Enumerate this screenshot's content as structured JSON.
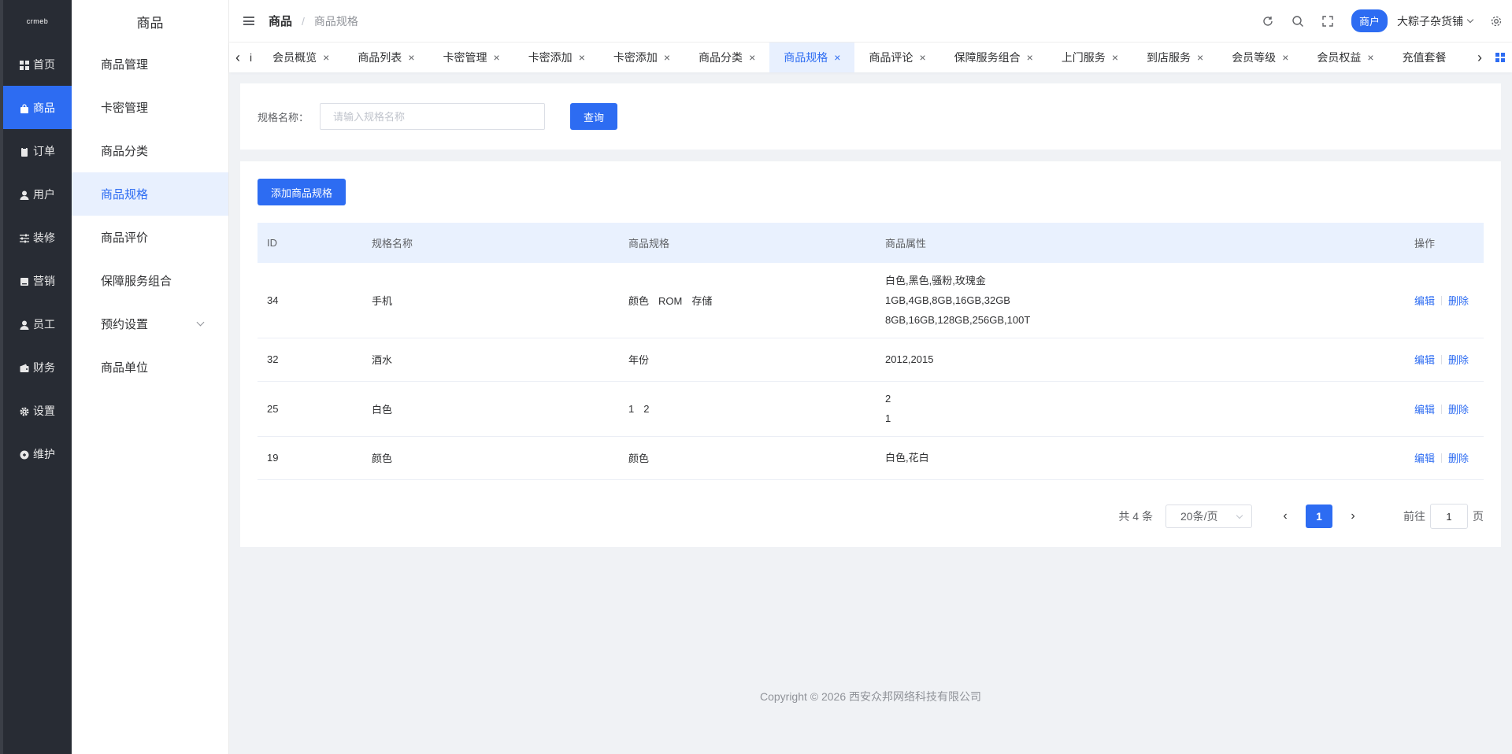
{
  "rail": {
    "logo": "crmeb",
    "items": [
      {
        "label": "首页",
        "icon": "grid-icon"
      },
      {
        "label": "商品",
        "icon": "bag-icon",
        "active": true
      },
      {
        "label": "订单",
        "icon": "clipboard-icon"
      },
      {
        "label": "用户",
        "icon": "user-icon"
      },
      {
        "label": "装修",
        "icon": "sliders-icon"
      },
      {
        "label": "营销",
        "icon": "book-icon"
      },
      {
        "label": "员工",
        "icon": "staff-icon"
      },
      {
        "label": "财务",
        "icon": "wallet-icon"
      },
      {
        "label": "设置",
        "icon": "gear-icon"
      },
      {
        "label": "维护",
        "icon": "wrench-icon"
      }
    ]
  },
  "sidebar": {
    "title": "商品",
    "items": [
      {
        "label": "商品管理"
      },
      {
        "label": "卡密管理"
      },
      {
        "label": "商品分类"
      },
      {
        "label": "商品规格",
        "active": true
      },
      {
        "label": "商品评价"
      },
      {
        "label": "保障服务组合"
      },
      {
        "label": "预约设置",
        "expandable": true
      },
      {
        "label": "商品单位"
      }
    ]
  },
  "header": {
    "breadcrumb_root": "商品",
    "breadcrumb_sep": "/",
    "breadcrumb_current": "商品规格",
    "badge": "商户",
    "store_name": "大粽子杂货铺"
  },
  "tabs": [
    {
      "label": "i"
    },
    {
      "label": "会员概览"
    },
    {
      "label": "商品列表"
    },
    {
      "label": "卡密管理"
    },
    {
      "label": "卡密添加"
    },
    {
      "label": "卡密添加"
    },
    {
      "label": "商品分类"
    },
    {
      "label": "商品规格",
      "active": true
    },
    {
      "label": "商品评论"
    },
    {
      "label": "保障服务组合"
    },
    {
      "label": "上门服务"
    },
    {
      "label": "到店服务"
    },
    {
      "label": "会员等级"
    },
    {
      "label": "会员权益"
    },
    {
      "label": "充值套餐"
    }
  ],
  "filter": {
    "label": "规格名称：",
    "placeholder": "请输入规格名称",
    "query_button": "查询"
  },
  "list": {
    "add_button": "添加商品规格",
    "columns": [
      "ID",
      "规格名称",
      "商品规格",
      "商品属性",
      "操作"
    ],
    "rows": [
      {
        "id": "34",
        "name": "手机",
        "specs": [
          "颜色",
          "ROM",
          "存储"
        ],
        "attrs": [
          "白色,黑色,骚粉,玫瑰金",
          "1GB,4GB,8GB,16GB,32GB",
          "8GB,16GB,128GB,256GB,100T"
        ]
      },
      {
        "id": "32",
        "name": "酒水",
        "specs": [
          "年份"
        ],
        "attrs": [
          "2012,2015"
        ]
      },
      {
        "id": "25",
        "name": "白色",
        "specs": [
          "1",
          "2"
        ],
        "attrs": [
          "2",
          "1"
        ]
      },
      {
        "id": "19",
        "name": "颜色",
        "specs": [
          "颜色"
        ],
        "attrs": [
          "白色,花白"
        ]
      }
    ],
    "edit_label": "编辑",
    "delete_label": "删除"
  },
  "pagination": {
    "total": "共 4 条",
    "page_size": "20条/页",
    "current_page": "1",
    "goto_prefix": "前往",
    "goto_value": "1",
    "goto_suffix": "页"
  },
  "footer": "Copyright © 2026 西安众邦网络科技有限公司",
  "colors": {
    "primary": "#2d6cf2",
    "rail_bg": "#282c34",
    "header_row": "#e9f1fe"
  }
}
